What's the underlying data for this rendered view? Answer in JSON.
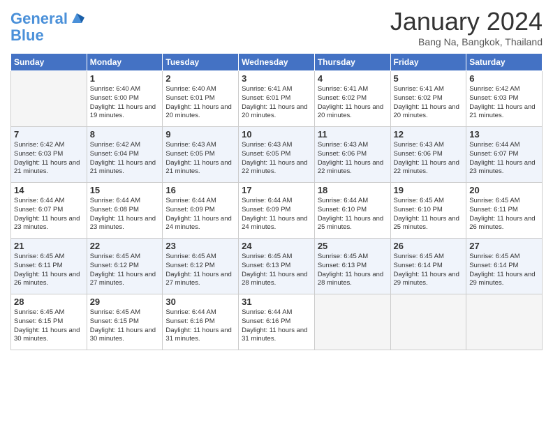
{
  "header": {
    "logo_line1": "General",
    "logo_line2": "Blue",
    "month": "January 2024",
    "location": "Bang Na, Bangkok, Thailand"
  },
  "days_of_week": [
    "Sunday",
    "Monday",
    "Tuesday",
    "Wednesday",
    "Thursday",
    "Friday",
    "Saturday"
  ],
  "weeks": [
    [
      {
        "day": "",
        "empty": true
      },
      {
        "day": "1",
        "sunrise": "6:40 AM",
        "sunset": "6:00 PM",
        "daylight": "11 hours and 19 minutes."
      },
      {
        "day": "2",
        "sunrise": "6:40 AM",
        "sunset": "6:01 PM",
        "daylight": "11 hours and 20 minutes."
      },
      {
        "day": "3",
        "sunrise": "6:41 AM",
        "sunset": "6:01 PM",
        "daylight": "11 hours and 20 minutes."
      },
      {
        "day": "4",
        "sunrise": "6:41 AM",
        "sunset": "6:02 PM",
        "daylight": "11 hours and 20 minutes."
      },
      {
        "day": "5",
        "sunrise": "6:41 AM",
        "sunset": "6:02 PM",
        "daylight": "11 hours and 20 minutes."
      },
      {
        "day": "6",
        "sunrise": "6:42 AM",
        "sunset": "6:03 PM",
        "daylight": "11 hours and 21 minutes."
      }
    ],
    [
      {
        "day": "7",
        "sunrise": "6:42 AM",
        "sunset": "6:03 PM",
        "daylight": "11 hours and 21 minutes."
      },
      {
        "day": "8",
        "sunrise": "6:42 AM",
        "sunset": "6:04 PM",
        "daylight": "11 hours and 21 minutes."
      },
      {
        "day": "9",
        "sunrise": "6:43 AM",
        "sunset": "6:05 PM",
        "daylight": "11 hours and 21 minutes."
      },
      {
        "day": "10",
        "sunrise": "6:43 AM",
        "sunset": "6:05 PM",
        "daylight": "11 hours and 22 minutes."
      },
      {
        "day": "11",
        "sunrise": "6:43 AM",
        "sunset": "6:06 PM",
        "daylight": "11 hours and 22 minutes."
      },
      {
        "day": "12",
        "sunrise": "6:43 AM",
        "sunset": "6:06 PM",
        "daylight": "11 hours and 22 minutes."
      },
      {
        "day": "13",
        "sunrise": "6:44 AM",
        "sunset": "6:07 PM",
        "daylight": "11 hours and 23 minutes."
      }
    ],
    [
      {
        "day": "14",
        "sunrise": "6:44 AM",
        "sunset": "6:07 PM",
        "daylight": "11 hours and 23 minutes."
      },
      {
        "day": "15",
        "sunrise": "6:44 AM",
        "sunset": "6:08 PM",
        "daylight": "11 hours and 23 minutes."
      },
      {
        "day": "16",
        "sunrise": "6:44 AM",
        "sunset": "6:09 PM",
        "daylight": "11 hours and 24 minutes."
      },
      {
        "day": "17",
        "sunrise": "6:44 AM",
        "sunset": "6:09 PM",
        "daylight": "11 hours and 24 minutes."
      },
      {
        "day": "18",
        "sunrise": "6:44 AM",
        "sunset": "6:10 PM",
        "daylight": "11 hours and 25 minutes."
      },
      {
        "day": "19",
        "sunrise": "6:45 AM",
        "sunset": "6:10 PM",
        "daylight": "11 hours and 25 minutes."
      },
      {
        "day": "20",
        "sunrise": "6:45 AM",
        "sunset": "6:11 PM",
        "daylight": "11 hours and 26 minutes."
      }
    ],
    [
      {
        "day": "21",
        "sunrise": "6:45 AM",
        "sunset": "6:11 PM",
        "daylight": "11 hours and 26 minutes."
      },
      {
        "day": "22",
        "sunrise": "6:45 AM",
        "sunset": "6:12 PM",
        "daylight": "11 hours and 27 minutes."
      },
      {
        "day": "23",
        "sunrise": "6:45 AM",
        "sunset": "6:12 PM",
        "daylight": "11 hours and 27 minutes."
      },
      {
        "day": "24",
        "sunrise": "6:45 AM",
        "sunset": "6:13 PM",
        "daylight": "11 hours and 28 minutes."
      },
      {
        "day": "25",
        "sunrise": "6:45 AM",
        "sunset": "6:13 PM",
        "daylight": "11 hours and 28 minutes."
      },
      {
        "day": "26",
        "sunrise": "6:45 AM",
        "sunset": "6:14 PM",
        "daylight": "11 hours and 29 minutes."
      },
      {
        "day": "27",
        "sunrise": "6:45 AM",
        "sunset": "6:14 PM",
        "daylight": "11 hours and 29 minutes."
      }
    ],
    [
      {
        "day": "28",
        "sunrise": "6:45 AM",
        "sunset": "6:15 PM",
        "daylight": "11 hours and 30 minutes."
      },
      {
        "day": "29",
        "sunrise": "6:45 AM",
        "sunset": "6:15 PM",
        "daylight": "11 hours and 30 minutes."
      },
      {
        "day": "30",
        "sunrise": "6:44 AM",
        "sunset": "6:16 PM",
        "daylight": "11 hours and 31 minutes."
      },
      {
        "day": "31",
        "sunrise": "6:44 AM",
        "sunset": "6:16 PM",
        "daylight": "11 hours and 31 minutes."
      },
      {
        "day": "",
        "empty": true
      },
      {
        "day": "",
        "empty": true
      },
      {
        "day": "",
        "empty": true
      }
    ]
  ]
}
